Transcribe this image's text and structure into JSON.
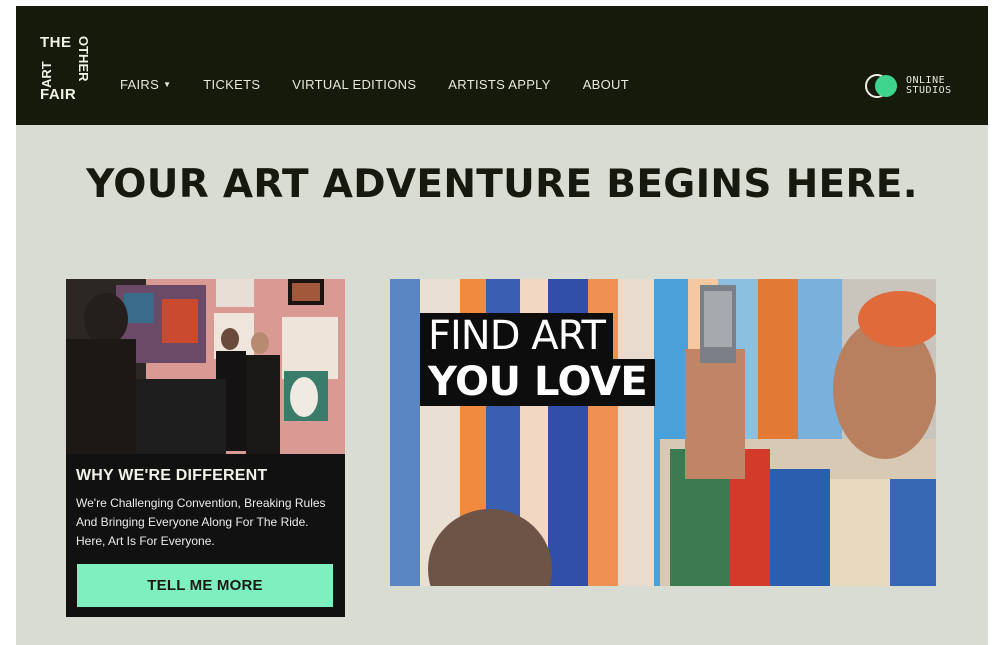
{
  "logo": {
    "the": "THE",
    "art": "ART",
    "other": "OTHER",
    "fair": "FAIR"
  },
  "nav": {
    "items": [
      {
        "label": "FAIRS",
        "dropdown": true
      },
      {
        "label": "TICKETS"
      },
      {
        "label": "VIRTUAL EDITIONS"
      },
      {
        "label": "ARTISTS APPLY"
      },
      {
        "label": "ABOUT"
      }
    ],
    "online_studios": {
      "line1": "ONLINE",
      "line2": "STUDIOS",
      "icon": "overlapping-circles-icon"
    }
  },
  "hero": {
    "headline": "YOUR ART ADVENTURE BEGINS HERE.",
    "banner_line1": "FIND ART",
    "banner_line2": "YOU LOVE"
  },
  "card": {
    "title": "WHY WE'RE DIFFERENT",
    "text": "We're Challenging Convention, Breaking Rules And Bringing Everyone Along For The Ride. Here, Art Is For Everyone.",
    "button": "TELL ME MORE"
  },
  "colors": {
    "nav_bg": "#161a0b",
    "page_bg": "#d9dcd3",
    "accent": "#7ef0c0",
    "online_dot": "#3fd48e",
    "headline": "#17190e"
  }
}
